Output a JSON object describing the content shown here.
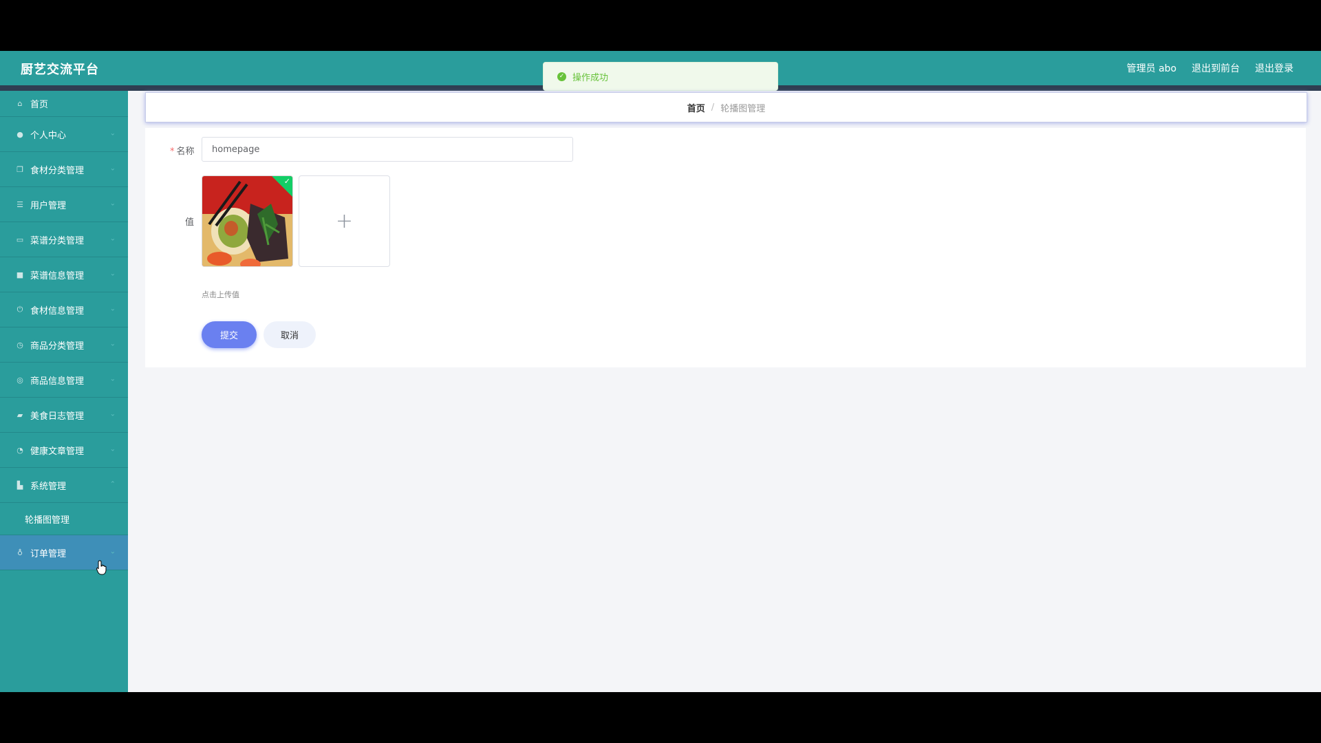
{
  "header": {
    "app_title": "厨艺交流平台",
    "links": [
      "管理员 abo",
      "退出到前台",
      "退出登录"
    ]
  },
  "toast": {
    "message": "操作成功",
    "type": "success"
  },
  "sidebar": {
    "items": [
      {
        "label": "首页",
        "icon": "home-icon"
      },
      {
        "label": "个人中心",
        "icon": "user-icon"
      },
      {
        "label": "食材分类管理",
        "icon": "copy-icon"
      },
      {
        "label": "用户管理",
        "icon": "list-icon"
      },
      {
        "label": "菜谱分类管理",
        "icon": "folder-icon"
      },
      {
        "label": "菜谱信息管理",
        "icon": "message-icon"
      },
      {
        "label": "食材信息管理",
        "icon": "power-icon"
      },
      {
        "label": "商品分类管理",
        "icon": "clock-icon"
      },
      {
        "label": "商品信息管理",
        "icon": "compass-icon"
      },
      {
        "label": "美食日志管理",
        "icon": "thumb-icon"
      },
      {
        "label": "健康文章管理",
        "icon": "gauge-icon"
      },
      {
        "label": "系统管理",
        "icon": "chart-icon"
      },
      {
        "label": "订单管理",
        "icon": "mic-icon"
      }
    ],
    "submenu": {
      "label": "轮播图管理"
    }
  },
  "breadcrumb": {
    "home": "首页",
    "separator": "/",
    "current": "轮播图管理"
  },
  "form": {
    "name_label": "名称",
    "name_value": "homepage",
    "value_label": "值",
    "upload_hint": "点击上传值",
    "submit_label": "提交",
    "cancel_label": "取消"
  },
  "colors": {
    "sidebar_bg": "#2a9d9c",
    "header_strip": "#2f3e52",
    "accent": "#6a80f0",
    "success": "#67c23a"
  }
}
